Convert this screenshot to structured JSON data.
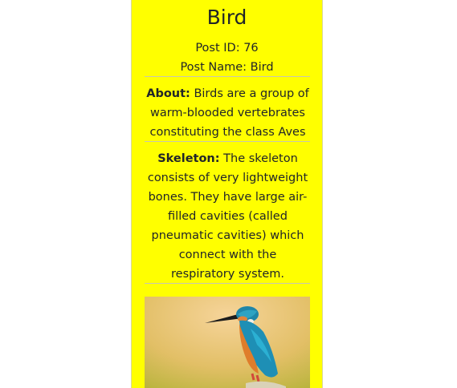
{
  "card": {
    "title": "Bird",
    "post_id_line": "Post ID: 76",
    "post_name_line": "Post Name: Bird",
    "about": {
      "label": "About:",
      "text": "Birds are a group of warm-blooded vertebrates constituting the class Aves"
    },
    "skeleton": {
      "label": "Skeleton:",
      "text": "The skeleton consists of very lightweight bones. They have large air-filled cavities (called pneumatic cavities) which connect with the respiratory system."
    },
    "image": {
      "subject": "kingfisher-photo"
    }
  },
  "colors": {
    "card_background": "#ffff00",
    "page_background": "#ffffff",
    "divider": "#c7c7b0"
  }
}
